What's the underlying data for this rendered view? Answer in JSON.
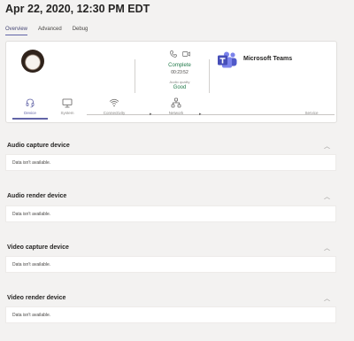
{
  "header": {
    "title": "Apr 22, 2020, 12:30 PM EDT"
  },
  "tabs": [
    {
      "label": "Overview",
      "active": true
    },
    {
      "label": "Advanced",
      "active": false
    },
    {
      "label": "Debug",
      "active": false
    }
  ],
  "call": {
    "status": "Complete",
    "duration": "00:23:52",
    "audio_quality_label": "Audio quality",
    "audio_quality": "Good",
    "app_name": "Microsoft Teams"
  },
  "steps": [
    {
      "label": "Device",
      "icon": "headset-icon",
      "active": true
    },
    {
      "label": "System",
      "icon": "monitor-icon",
      "active": false
    },
    {
      "label": "Connectivity",
      "icon": "wifi-icon",
      "active": false
    },
    {
      "label": "Network",
      "icon": "network-icon",
      "active": false
    },
    {
      "label": "Service",
      "icon": "",
      "active": false
    }
  ],
  "sections": [
    {
      "title": "Audio capture device",
      "message": "Data isn't available."
    },
    {
      "title": "Audio render device",
      "message": "Data isn't available."
    },
    {
      "title": "Video capture device",
      "message": "Data isn't available."
    },
    {
      "title": "Video render device",
      "message": "Data isn't available."
    }
  ],
  "colors": {
    "accent": "#6264a7",
    "good": "#237b4b",
    "background": "#f3f2f1",
    "teams": "#464eb8"
  }
}
